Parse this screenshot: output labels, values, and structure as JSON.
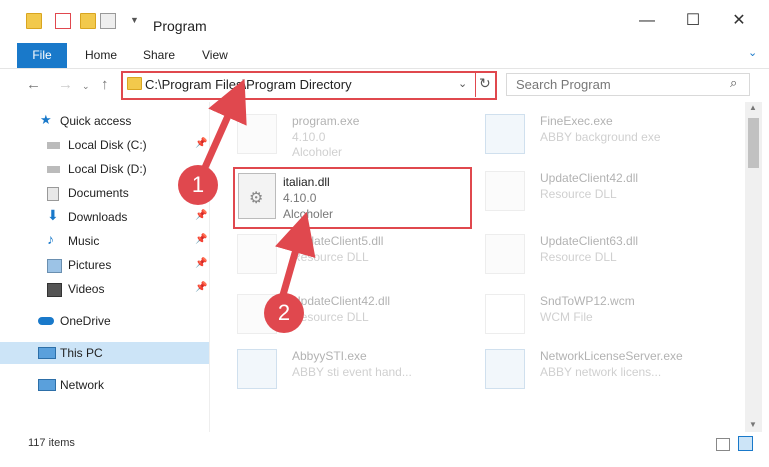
{
  "window": {
    "title": "Program"
  },
  "ribbon": {
    "file": "File",
    "home": "Home",
    "share": "Share",
    "view": "View"
  },
  "address": {
    "path": "C:\\Program Files\\Program Directory"
  },
  "search": {
    "placeholder": "Search Program"
  },
  "sidebar": {
    "items": [
      {
        "label": "Quick access",
        "icon": "star-icon",
        "pinned": false
      },
      {
        "label": "Local Disk (C:)",
        "icon": "drive-icon",
        "pinned": true
      },
      {
        "label": "Local Disk (D:)",
        "icon": "drive-icon",
        "pinned": false
      },
      {
        "label": "Documents",
        "icon": "documents-icon",
        "pinned": true
      },
      {
        "label": "Downloads",
        "icon": "download-icon",
        "pinned": true
      },
      {
        "label": "Music",
        "icon": "music-icon",
        "pinned": true
      },
      {
        "label": "Pictures",
        "icon": "pictures-icon",
        "pinned": true
      },
      {
        "label": "Videos",
        "icon": "videos-icon",
        "pinned": true
      },
      {
        "label": "OneDrive",
        "icon": "cloud-icon",
        "pinned": false
      },
      {
        "label": "This PC",
        "icon": "pc-icon",
        "pinned": false,
        "selected": true
      },
      {
        "label": "Network",
        "icon": "network-icon",
        "pinned": false
      }
    ]
  },
  "files": [
    {
      "name": "program.exe",
      "line1": "4.10.0",
      "line2": "Alcoholer"
    },
    {
      "name": "FineExec.exe",
      "line1": "ABBY background exe"
    },
    {
      "name": "UpdateClient42.dll",
      "line1": "Resource DLL"
    },
    {
      "name": "UpdateClient5.dll",
      "line1": "Resource DLL"
    },
    {
      "name": "UpdateClient63.dll",
      "line1": "Resource DLL"
    },
    {
      "name": "UpdateClient42.dll",
      "line1": "Resource DLL"
    },
    {
      "name": "SndToWP12.wcm",
      "line1": "WCM File"
    },
    {
      "name": "AbbyySTI.exe",
      "line1": "ABBY sti event hand..."
    },
    {
      "name": "NetworkLicenseServer.exe",
      "line1": "ABBY network licens..."
    }
  ],
  "highlighted_file": {
    "name": "italian.dll",
    "version": "4.10.0",
    "company": "Alcoholer"
  },
  "status": {
    "count": "117 items"
  },
  "annotations": {
    "step1": "1",
    "step2": "2"
  },
  "colors": {
    "accent": "#1979ca",
    "highlight": "#e0484e"
  }
}
